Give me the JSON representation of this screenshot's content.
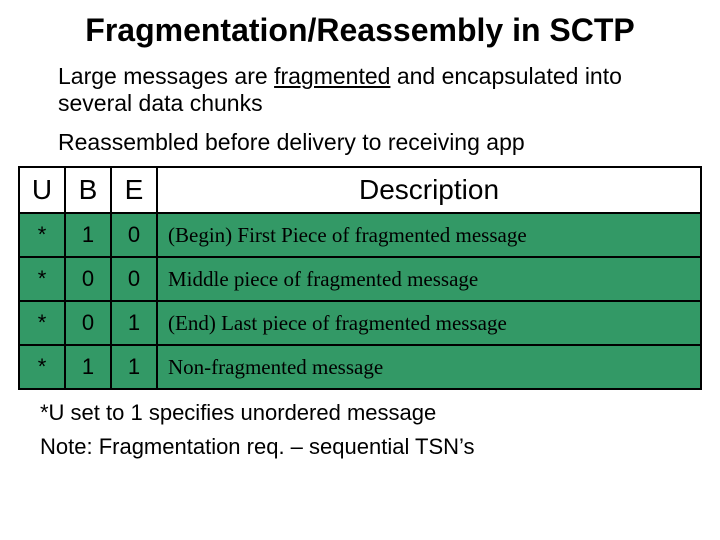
{
  "title": "Fragmentation/Reassembly in SCTP",
  "lead_pre": "Large messages are ",
  "lead_underlined": "fragmented",
  "lead_post": " and encapsulated into several data chunks",
  "lead2": "Reassembled before delivery to receiving app",
  "headers": {
    "u": "U",
    "b": "B",
    "e": "E",
    "desc": "Description"
  },
  "rows": [
    {
      "u": "*",
      "b": "1",
      "e": "0",
      "desc": "(Begin) First Piece of fragmented message"
    },
    {
      "u": "*",
      "b": "0",
      "e": "0",
      "desc": "Middle piece of fragmented message"
    },
    {
      "u": "*",
      "b": "0",
      "e": "1",
      "desc": "(End) Last piece of fragmented message"
    },
    {
      "u": "*",
      "b": "1",
      "e": "1",
      "desc": "Non-fragmented message"
    }
  ],
  "foot1": "*U set to 1 specifies unordered message",
  "foot2": "Note: Fragmentation req. – sequential TSN’s",
  "chart_data": {
    "type": "table",
    "columns": [
      "U",
      "B",
      "E",
      "Description"
    ],
    "rows": [
      [
        "*",
        1,
        0,
        "(Begin) First Piece of fragmented message"
      ],
      [
        "*",
        0,
        0,
        "Middle piece of fragmented message"
      ],
      [
        "*",
        0,
        1,
        "(End) Last piece of fragmented message"
      ],
      [
        "*",
        1,
        1,
        "Non-fragmented message"
      ]
    ]
  }
}
